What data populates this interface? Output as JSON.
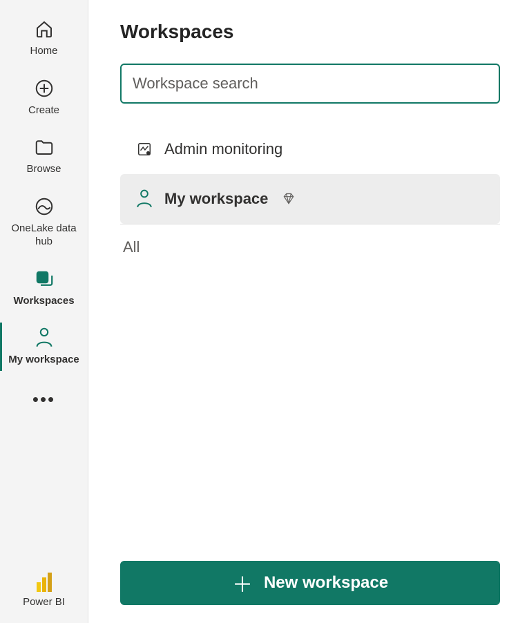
{
  "sidebar": {
    "items": [
      {
        "label": "Home"
      },
      {
        "label": "Create"
      },
      {
        "label": "Browse"
      },
      {
        "label": "OneLake data hub"
      },
      {
        "label": "Workspaces"
      },
      {
        "label": "My workspace"
      }
    ],
    "footer_label": "Power BI"
  },
  "main": {
    "title": "Workspaces",
    "search_placeholder": "Workspace search",
    "workspaces": [
      {
        "label": "Admin monitoring"
      },
      {
        "label": "My workspace"
      }
    ],
    "section_label": "All",
    "new_button_label": "New workspace"
  }
}
